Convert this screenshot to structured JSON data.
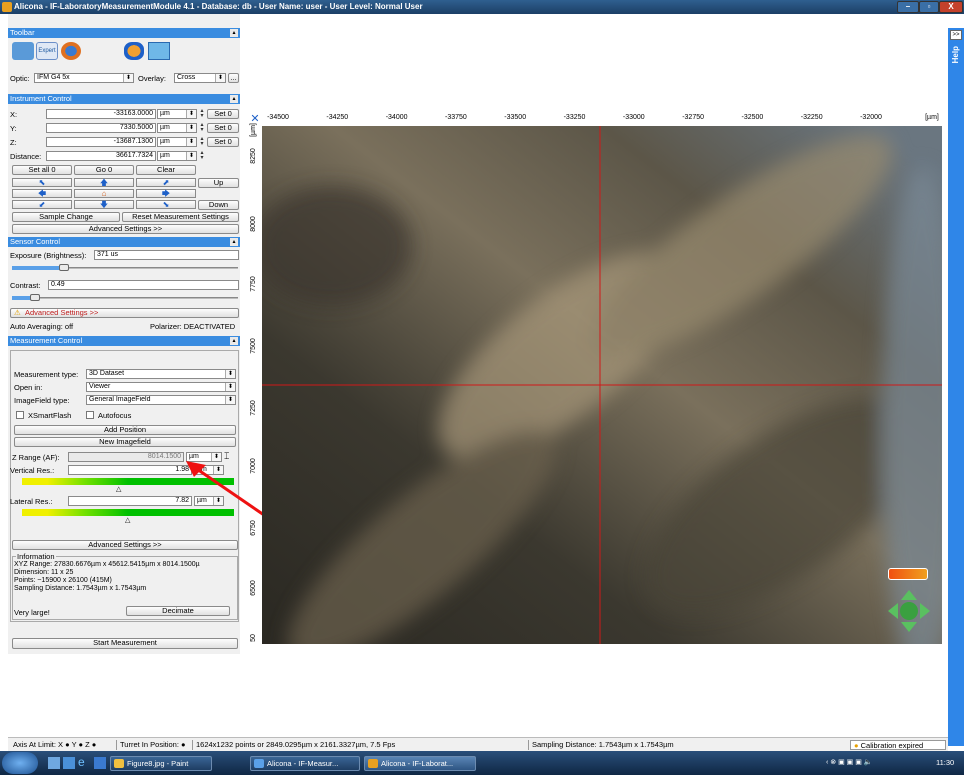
{
  "window": {
    "title": "Alicona - IF-LaboratoryMeasurementModule 4.1 - Database: db - User Name: user - User Level: Normal User",
    "buttons": [
      "–",
      "▫",
      "X"
    ]
  },
  "toolbar": {
    "header": "Toolbar",
    "expert_label": "Expert",
    "optic_label": "Optic:",
    "optic_value": "IFM G4 5x",
    "overlay_label": "Overlay:",
    "overlay_value": "Cross",
    "more_label": "..."
  },
  "instrument": {
    "header": "Instrument Control",
    "x_label": "X:",
    "x_value": "-33163.0000",
    "y_label": "Y:",
    "y_value": "7330.5000",
    "z_label": "Z:",
    "z_value": "-13687.1300",
    "distance_label": "Distance:",
    "distance_value": "36617.7324",
    "unit": "µm",
    "set0": "Set 0",
    "set_all0": "Set all 0",
    "go0": "Go 0",
    "clear": "Clear",
    "up": "Up",
    "down": "Down",
    "sample_change": "Sample Change",
    "reset_settings": "Reset Measurement Settings",
    "advanced": "Advanced Settings >>"
  },
  "sensor": {
    "header": "Sensor Control",
    "exposure_label": "Exposure (Brightness):",
    "exposure_value": "371 us",
    "exposure_level": 0.23,
    "contrast_label": "Contrast:",
    "contrast_value": "0.49",
    "contrast_level": 0.1,
    "advanced": "Advanced Settings >>",
    "auto_averaging": "Auto Averaging: off",
    "polarizer": "Polarizer: DEACTIVATED"
  },
  "measurement": {
    "header": "Measurement Control",
    "type_label": "Measurement type:",
    "type_value": "3D Dataset",
    "open_label": "Open in:",
    "open_value": "Viewer",
    "imagefield_label": "ImageField type:",
    "imagefield_value": "General ImageField",
    "xsmartflash": "XSmartFlash",
    "autofocus": "Autofocus",
    "add_position": "Add Position",
    "new_imagefield": "New Imagefield",
    "zrange_label": "Z Range (AF):",
    "zrange_value": "8014.1500",
    "vertical_label": "Vertical Res.:",
    "vertical_value": "1.98",
    "lateral_label": "Lateral Res.:",
    "lateral_value": "7.82",
    "unit": "µm",
    "advanced": "Advanced Settings >>",
    "info_title": "Information",
    "info_lines": [
      "XYZ Range: 27830.6676µm x 45612.5415µm x 8014.1500µ",
      "Dimension: 11 x 25",
      "Points: ~15900 x 26100 (415M)",
      "Sampling Distance: 1.7543µm x 1.7543µm"
    ],
    "very_large": "Very large!",
    "decimate": "Decimate",
    "start": "Start Measurement"
  },
  "ruler": {
    "x_ticks": [
      "-34500",
      "-34250",
      "-34000",
      "-33750",
      "-33500",
      "-33250",
      "-33000",
      "-32750",
      "-32500",
      "-32250",
      "-32000"
    ],
    "x_unit": "[µm]",
    "y_ticks": [
      "8250",
      "8000",
      "7750",
      "7500",
      "7250",
      "7000",
      "6750",
      "6500",
      "50"
    ],
    "y_unit": "[µm]"
  },
  "help": {
    "label": "Help",
    "expand": ">>"
  },
  "status": {
    "axis_limit": "Axis At Limit: X ● Y ● Z ●",
    "turret": "Turret In Position: ●",
    "points": "1624x1232 points or 2849.0295µm x 2161.3327µm, 7.5 Fps",
    "sampling": "Sampling Distance: 1.7543µm x 1.7543µm",
    "calibration": "Calibration expired"
  },
  "taskbar": {
    "tasks": [
      "Figure8.jpg - Paint",
      "Alicona - IF-Measur...",
      "Alicona - IF-Laborat..."
    ],
    "clock": "11:30"
  }
}
